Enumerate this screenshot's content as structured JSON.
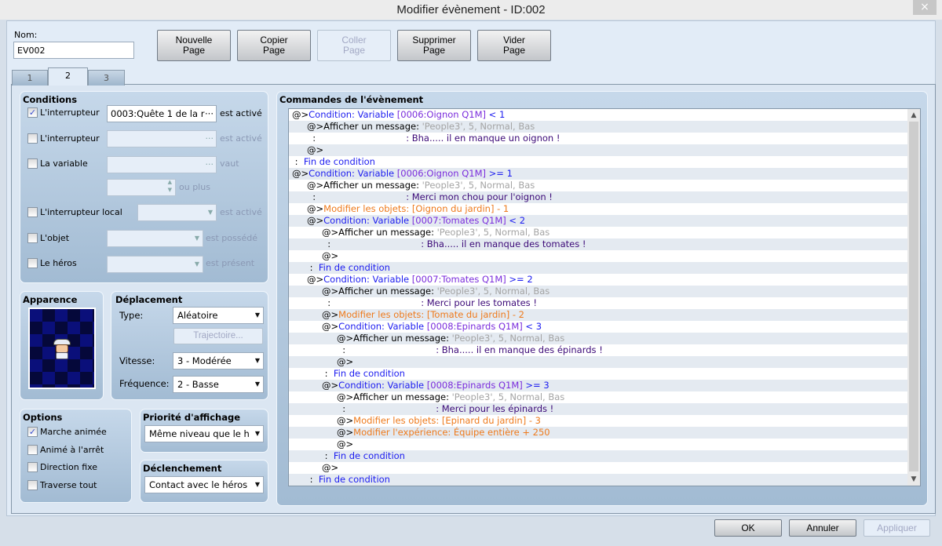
{
  "window": {
    "title": "Modifier évènement - ID:002",
    "close_icon": "×"
  },
  "name": {
    "label": "Nom:",
    "value": "EV002"
  },
  "toolbar": [
    {
      "line1": "Nouvelle",
      "line2": "Page",
      "enabled": true
    },
    {
      "line1": "Copier",
      "line2": "Page",
      "enabled": true
    },
    {
      "line1": "Coller",
      "line2": "Page",
      "enabled": false
    },
    {
      "line1": "Supprimer",
      "line2": "Page",
      "enabled": true
    },
    {
      "line1": "Vider",
      "line2": "Page",
      "enabled": true
    }
  ],
  "tabs": [
    {
      "label": "1"
    },
    {
      "label": "2",
      "active": true
    },
    {
      "label": "3"
    }
  ],
  "conditions": {
    "title": "Conditions",
    "switch1": {
      "label": "L'interrupteur",
      "checked": true,
      "value": "0003:Quête 1 de la r",
      "suffix": "est activé"
    },
    "switch2": {
      "label": "L'interrupteur",
      "checked": false,
      "value": "",
      "suffix": "est activé"
    },
    "variable": {
      "label": "La variable",
      "checked": false,
      "value": "",
      "suffix": "vaut",
      "spin_suffix": "ou plus"
    },
    "self_switch": {
      "label": "L'interrupteur local",
      "checked": false,
      "suffix": "est activé"
    },
    "item": {
      "label": "L'objet",
      "checked": false,
      "suffix": "est possédé"
    },
    "actor": {
      "label": "Le héros",
      "checked": false,
      "suffix": "est présent"
    }
  },
  "appearance": {
    "title": "Apparence"
  },
  "movement": {
    "title": "Déplacement",
    "type_label": "Type:",
    "type_value": "Aléatoire",
    "route_button": "Trajectoire...",
    "speed_label": "Vitesse:",
    "speed_value": "3 - Modérée",
    "freq_label": "Fréquence:",
    "freq_value": "2 - Basse"
  },
  "options": {
    "title": "Options",
    "items": [
      {
        "label": "Marche animée",
        "checked": true
      },
      {
        "label": "Animé à l'arrêt",
        "checked": false
      },
      {
        "label": "Direction fixe",
        "checked": false
      },
      {
        "label": "Traverse tout",
        "checked": false
      }
    ]
  },
  "priority": {
    "title": "Priorité d'affichage",
    "value": "Même niveau que le h"
  },
  "trigger": {
    "title": "Déclenchement",
    "value": "Contact avec le héros"
  },
  "commands": {
    "title": "Commandes de l'évènement",
    "colors": {
      "k": "#000000",
      "c": "#1c1cf0",
      "v": "#7a2cdc",
      "g": "#a4a4a4",
      "m": "#3c0a78",
      "o": "#ee7a1c"
    },
    "lines": [
      {
        "i": 0,
        "s": [
          [
            "k",
            "@>"
          ],
          [
            "c",
            "Condition: Variable "
          ],
          [
            "v",
            "[0006:Oignon Q1M]"
          ],
          [
            "c",
            " < 1"
          ]
        ]
      },
      {
        "i": 1,
        "s": [
          [
            "k",
            "@>Afficher un message: "
          ],
          [
            "g",
            "'People3', 5, Normal, Bas"
          ]
        ]
      },
      {
        "i": 1,
        "cont": true,
        "s": [
          [
            "m",
            "Bha..... il en manque un oignon !"
          ]
        ]
      },
      {
        "i": 1,
        "s": [
          [
            "k",
            "@>"
          ]
        ]
      },
      {
        "i": 0,
        "s": [
          [
            "k",
            " :  "
          ],
          [
            "c",
            "Fin de condition"
          ]
        ]
      },
      {
        "i": 0,
        "s": [
          [
            "k",
            "@>"
          ],
          [
            "c",
            "Condition: Variable "
          ],
          [
            "v",
            "[0006:Oignon Q1M]"
          ],
          [
            "c",
            " >= 1"
          ]
        ]
      },
      {
        "i": 1,
        "s": [
          [
            "k",
            "@>Afficher un message: "
          ],
          [
            "g",
            "'People3', 5, Normal, Bas"
          ]
        ]
      },
      {
        "i": 1,
        "cont": true,
        "s": [
          [
            "m",
            "Merci mon chou pour l'oignon !"
          ]
        ]
      },
      {
        "i": 1,
        "s": [
          [
            "k",
            "@>"
          ],
          [
            "o",
            "Modifier les objets: [Oignon du jardin] - 1"
          ]
        ]
      },
      {
        "i": 1,
        "s": [
          [
            "k",
            "@>"
          ],
          [
            "c",
            "Condition: Variable "
          ],
          [
            "v",
            "[0007:Tomates Q1M]"
          ],
          [
            "c",
            " < 2"
          ]
        ]
      },
      {
        "i": 2,
        "s": [
          [
            "k",
            "@>Afficher un message: "
          ],
          [
            "g",
            "'People3', 5, Normal, Bas"
          ]
        ]
      },
      {
        "i": 2,
        "cont": true,
        "s": [
          [
            "m",
            "Bha..... il en manque des tomates !"
          ]
        ]
      },
      {
        "i": 2,
        "s": [
          [
            "k",
            "@>"
          ]
        ]
      },
      {
        "i": 1,
        "s": [
          [
            "k",
            " :  "
          ],
          [
            "c",
            "Fin de condition"
          ]
        ]
      },
      {
        "i": 1,
        "s": [
          [
            "k",
            "@>"
          ],
          [
            "c",
            "Condition: Variable "
          ],
          [
            "v",
            "[0007:Tomates Q1M]"
          ],
          [
            "c",
            " >= 2"
          ]
        ]
      },
      {
        "i": 2,
        "s": [
          [
            "k",
            "@>Afficher un message: "
          ],
          [
            "g",
            "'People3', 5, Normal, Bas"
          ]
        ]
      },
      {
        "i": 2,
        "cont": true,
        "s": [
          [
            "m",
            "Merci pour les tomates !"
          ]
        ]
      },
      {
        "i": 2,
        "s": [
          [
            "k",
            "@>"
          ],
          [
            "o",
            "Modifier les objets: [Tomate du jardin] - 2"
          ]
        ]
      },
      {
        "i": 2,
        "s": [
          [
            "k",
            "@>"
          ],
          [
            "c",
            "Condition: Variable "
          ],
          [
            "v",
            "[0008:Epinards Q1M]"
          ],
          [
            "c",
            " < 3"
          ]
        ]
      },
      {
        "i": 3,
        "s": [
          [
            "k",
            "@>Afficher un message: "
          ],
          [
            "g",
            "'People3', 5, Normal, Bas"
          ]
        ]
      },
      {
        "i": 3,
        "cont": true,
        "s": [
          [
            "m",
            "Bha..... il en manque des épinards !"
          ]
        ]
      },
      {
        "i": 3,
        "s": [
          [
            "k",
            "@>"
          ]
        ]
      },
      {
        "i": 2,
        "s": [
          [
            "k",
            " :  "
          ],
          [
            "c",
            "Fin de condition"
          ]
        ]
      },
      {
        "i": 2,
        "s": [
          [
            "k",
            "@>"
          ],
          [
            "c",
            "Condition: Variable "
          ],
          [
            "v",
            "[0008:Epinards Q1M]"
          ],
          [
            "c",
            " >= 3"
          ]
        ]
      },
      {
        "i": 3,
        "s": [
          [
            "k",
            "@>Afficher un message: "
          ],
          [
            "g",
            "'People3', 5, Normal, Bas"
          ]
        ]
      },
      {
        "i": 3,
        "cont": true,
        "s": [
          [
            "m",
            "Merci pour les épinards !"
          ]
        ]
      },
      {
        "i": 3,
        "s": [
          [
            "k",
            "@>"
          ],
          [
            "o",
            "Modifier les objets: [Epinard du jardin] - 3"
          ]
        ]
      },
      {
        "i": 3,
        "s": [
          [
            "k",
            "@>"
          ],
          [
            "o",
            "Modifier l'expérience: Équipe entière + 250"
          ]
        ]
      },
      {
        "i": 3,
        "s": [
          [
            "k",
            "@>"
          ]
        ]
      },
      {
        "i": 2,
        "s": [
          [
            "k",
            " :  "
          ],
          [
            "c",
            "Fin de condition"
          ]
        ]
      },
      {
        "i": 2,
        "s": [
          [
            "k",
            "@>"
          ]
        ]
      },
      {
        "i": 1,
        "s": [
          [
            "k",
            " :  "
          ],
          [
            "c",
            "Fin de condition"
          ]
        ]
      }
    ]
  },
  "footer": {
    "ok": "OK",
    "cancel": "Annuler",
    "apply": "Appliquer"
  }
}
